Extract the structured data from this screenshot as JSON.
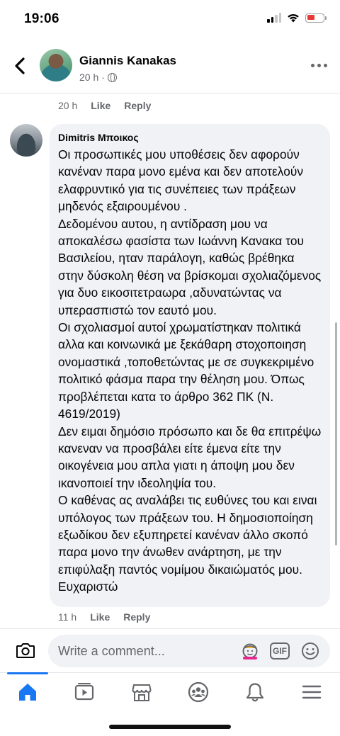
{
  "status_bar": {
    "time": "19:06"
  },
  "header": {
    "author": "Giannis Kanakas",
    "timestamp": "20 h",
    "separator": "·"
  },
  "previous_comment": {
    "time": "20 h",
    "like_label": "Like",
    "reply_label": "Reply"
  },
  "comment": {
    "author": "Dimitris Μποικος",
    "text": "Οι προσωπικές μου υποθέσεις δεν αφορούν κανέναν παρα μονο εμένα και δεν αποτελούν ελαφρυντικό για τις συνέπειες των πράξεων μηδενός εξαιρουμένου .\nΔεδομένου αυτου, η αντίδραση μου να αποκαλέσω φασίστα των Ιωάννη Κανακα του Βασιλείου, ηταν παράλογη, καθώς βρέθηκα στην δύσκολη θέση να βρίσκομαι σχολιαζόμενος για δυο εικοσιτετραωρα ,αδυνατώντας να υπερασπιστώ τον εαυτό μου.\nΟι σχολιασμοί αυτοί χρωματίστηκαν πολιτικά αλλα και κοινωνικά με ξεκάθαρη στοχοποιηση ονομαστικά ,τοποθετώντας με σε συγκεκριμένο πολιτικό φάσμα παρα την θέληση μου. Όπως προβλέπεται κατα το άρθρο 362 ΠΚ (Ν. 4619/2019)\nΔεν ειμαι δημόσιο πρόσωπο και δε θα επιτρέψω κανεναν να προσβάλει είτε έμενα είτε την οικογένεια μου απλα γιατι η άποψη μου δεν ικανοποιεί την ιδεοληψία του.\nΟ καθένας ας αναλάβει τις ευθύνες του και ειναι υπόλογος των πράξεων του. Η δημοσιοποίηση εξωδίκου δεν εξυπηρετεί κανέναν άλλο σκοπό παρα μονο την άνωθεν ανάρτηση, με την επιφύλαξη παντός νομίμου δικαιώματός μου.\nΕυχαριστώ",
    "time": "11 h",
    "like_label": "Like",
    "reply_label": "Reply"
  },
  "composer": {
    "placeholder": "Write a comment...",
    "gif_label": "GIF"
  },
  "tabs": [
    {
      "icon": "home-icon",
      "active": true
    },
    {
      "icon": "video-icon",
      "active": false
    },
    {
      "icon": "marketplace-icon",
      "active": false
    },
    {
      "icon": "groups-icon",
      "active": false
    },
    {
      "icon": "bell-icon",
      "active": false
    },
    {
      "icon": "menu-icon",
      "active": false
    }
  ],
  "colors": {
    "accent": "#1877f2",
    "secondary_text": "#65676b",
    "bubble_bg": "#f0f2f5"
  }
}
